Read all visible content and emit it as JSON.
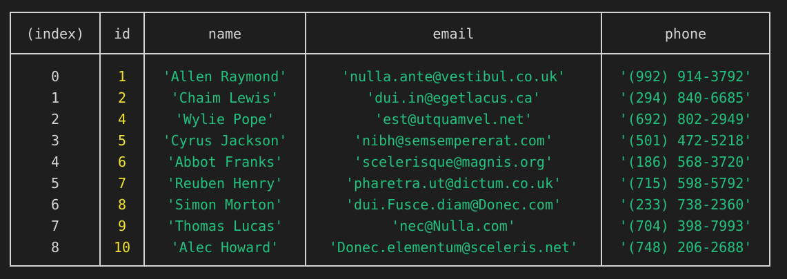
{
  "table": {
    "columns": [
      "(index)",
      "id",
      "name",
      "email",
      "phone"
    ],
    "rows": [
      {
        "index": "0",
        "id": "1",
        "name": "'Allen Raymond'",
        "email": "'nulla.ante@vestibul.co.uk'",
        "phone": "'(992) 914-3792'"
      },
      {
        "index": "1",
        "id": "2",
        "name": "'Chaim Lewis'",
        "email": "'dui.in@egetlacus.ca'",
        "phone": "'(294) 840-6685'"
      },
      {
        "index": "2",
        "id": "4",
        "name": "'Wylie Pope'",
        "email": "'est@utquamvel.net'",
        "phone": "'(692) 802-2949'"
      },
      {
        "index": "3",
        "id": "5",
        "name": "'Cyrus Jackson'",
        "email": "'nibh@semsempererat.com'",
        "phone": "'(501) 472-5218'"
      },
      {
        "index": "4",
        "id": "6",
        "name": "'Abbot Franks'",
        "email": "'scelerisque@magnis.org'",
        "phone": "'(186) 568-3720'"
      },
      {
        "index": "5",
        "id": "7",
        "name": "'Reuben Henry'",
        "email": "'pharetra.ut@dictum.co.uk'",
        "phone": "'(715) 598-5792'"
      },
      {
        "index": "6",
        "id": "8",
        "name": "'Simon Morton'",
        "email": "'dui.Fusce.diam@Donec.com'",
        "phone": "'(233) 738-2360'"
      },
      {
        "index": "7",
        "id": "9",
        "name": "'Thomas Lucas'",
        "email": "'nec@Nulla.com'",
        "phone": "'(704) 398-7993'"
      },
      {
        "index": "8",
        "id": "10",
        "name": "'Alec Howard'",
        "email": "'Donec.elementum@sceleris.net'",
        "phone": "'(748) 206-2688'"
      }
    ]
  },
  "colors": {
    "background": "#1e1e1e",
    "border": "#d4d4d4",
    "index_text": "#d4d4d4",
    "id_text": "#f0e130",
    "string_text": "#23c17d"
  }
}
